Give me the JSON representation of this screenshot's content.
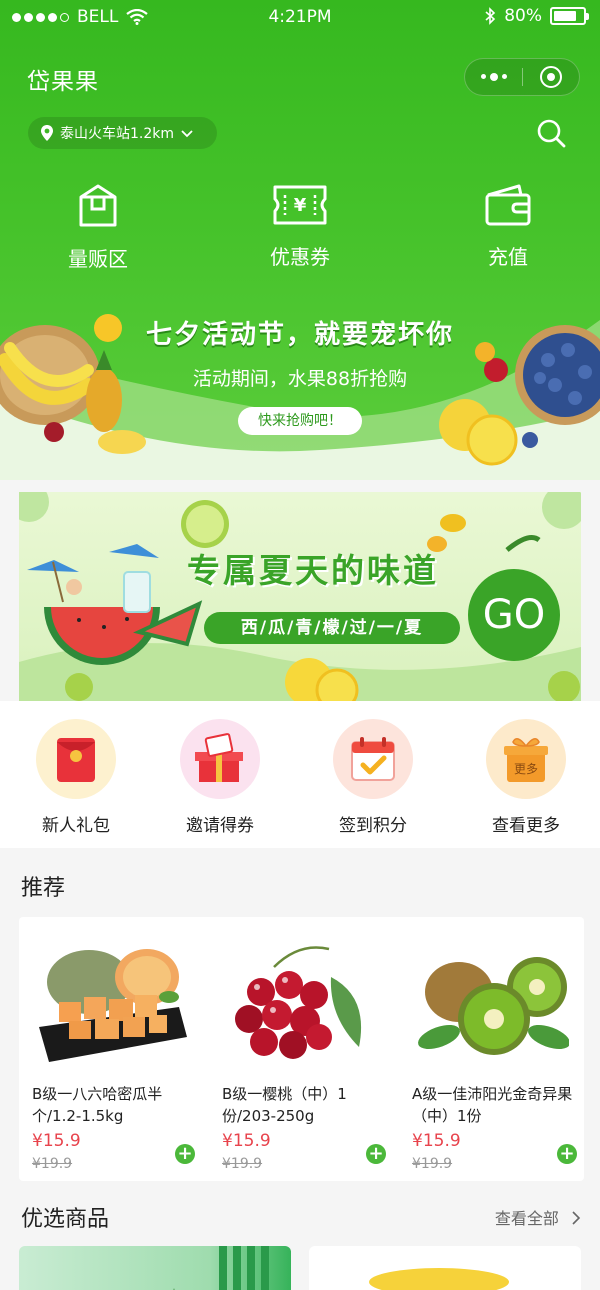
{
  "status": {
    "carrier": "BELL",
    "time": "4:21PM",
    "battery": "80%"
  },
  "app": {
    "title": "岱果果",
    "location": "泰山火车站1.2km"
  },
  "quick_nav": [
    {
      "label": "量贩区",
      "icon": "box-icon"
    },
    {
      "label": "优惠券",
      "icon": "coupon-icon"
    },
    {
      "label": "充值",
      "icon": "wallet-icon"
    }
  ],
  "promo_banner": {
    "title": "七夕活动节，就要宠坏你",
    "subtitle": "活动期间，水果88折抢购",
    "button": "快来抢购吧！"
  },
  "summer_banner": {
    "title": "专属夏天的味道",
    "subtitle": "西/瓜/青/檬/过/一/夏",
    "go": "GO"
  },
  "features": [
    {
      "label": "新人礼包",
      "icon": "red-envelope-icon"
    },
    {
      "label": "邀请得券",
      "icon": "gift-box-icon"
    },
    {
      "label": "签到积分",
      "icon": "calendar-check-icon"
    },
    {
      "label": "查看更多",
      "icon": "more-gift-icon",
      "badge": "更多"
    }
  ],
  "recommend": {
    "title": "推荐",
    "products": [
      {
        "name": "B级一八六哈密瓜半个/1.2-1.5kg",
        "price": "¥15.9",
        "old_price": "¥19.9"
      },
      {
        "name": "B级一樱桃（中）1份/203-250g",
        "price": "¥15.9",
        "old_price": "¥19.9"
      },
      {
        "name": "A级一佳沛阳光金奇异果（中）1份",
        "price": "¥15.9",
        "old_price": "¥19.9"
      }
    ]
  },
  "selected": {
    "title": "优选商品",
    "more": "查看全部"
  },
  "colors": {
    "primary_green": "#3ab820",
    "price_red": "#e8434c",
    "add_green": "#4bb83a"
  }
}
